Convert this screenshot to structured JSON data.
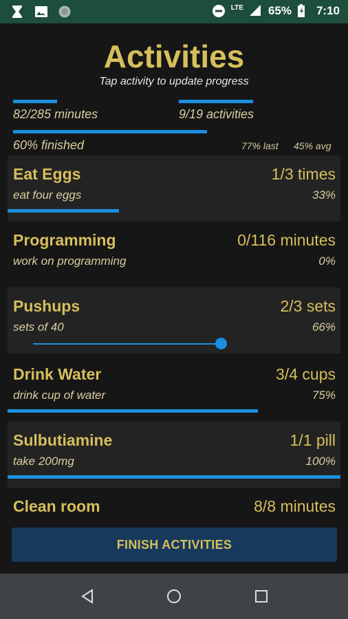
{
  "status_bar": {
    "network": "LTE",
    "battery": "65%",
    "time": "7:10",
    "icons": [
      "hourglass-icon",
      "image-icon",
      "circle-icon",
      "do-not-disturb-icon",
      "signal-icon",
      "battery-icon"
    ]
  },
  "header": {
    "title": "Activities",
    "subtitle": "Tap activity to update progress"
  },
  "summary": {
    "minutes": "82/285 minutes",
    "activities": "9/19 activities",
    "finished": "60% finished",
    "last": "77% last",
    "avg": "45% avg",
    "minutes_progress": 0.29,
    "activities_progress": 0.47,
    "finished_progress": 0.6
  },
  "activities": [
    {
      "name": "Eat Eggs",
      "count": "1/3 times",
      "desc": "eat four eggs",
      "pct": "33%",
      "progress": 0.33
    },
    {
      "name": "Programming",
      "count": "0/116 minutes",
      "desc": "work on programming",
      "pct": "0%",
      "progress": 0
    },
    {
      "name": "Pushups",
      "count": "2/3 sets",
      "desc": "sets of 40",
      "pct": "66%",
      "progress": 0.66
    },
    {
      "name": "Drink Water",
      "count": "3/4 cups",
      "desc": "drink cup of water",
      "pct": "75%",
      "progress": 0.75
    },
    {
      "name": "Sulbutiamine",
      "count": "1/1 pill",
      "desc": "take 200mg",
      "pct": "100%",
      "progress": 1.0
    },
    {
      "name": "Clean room",
      "count": "8/8 minutes"
    }
  ],
  "finish_button": "FINISH ACTIVITIES",
  "colors": {
    "accent_gold": "#d6bf5c",
    "progress_blue": "#1b8fe0",
    "status_bar_green": "#1d4d3c",
    "background": "#161616"
  }
}
